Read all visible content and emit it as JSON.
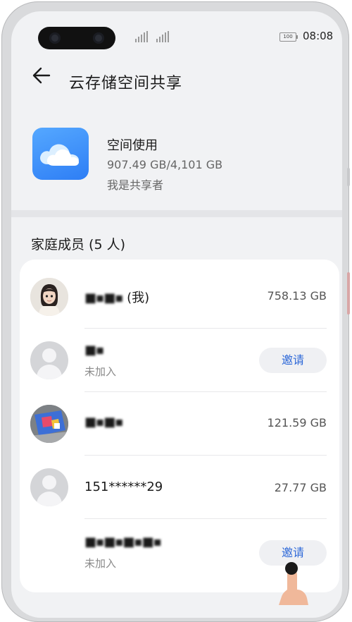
{
  "status_bar": {
    "time": "08:08",
    "battery": "100"
  },
  "header": {
    "title": "云存储空间共享"
  },
  "storage": {
    "title": "空间使用",
    "used": "907.49 GB/4,101 GB",
    "role": "我是共享者"
  },
  "family": {
    "title": "家庭成员 (5 人)",
    "members": [
      {
        "name": "　　",
        "self": "(我)",
        "size": "758.13 GB"
      },
      {
        "name": "　",
        "status": "未加入",
        "action": "邀请"
      },
      {
        "name": "　　",
        "size": "121.59 GB"
      },
      {
        "name": "151******29",
        "size": "27.77 GB"
      },
      {
        "name": "　　　　",
        "status": "未加入",
        "action": "邀请"
      }
    ]
  },
  "colors": {
    "accent": "#2d68d8",
    "tile": "#3b8ef7",
    "background": "#f1f2f4"
  },
  "icons": {
    "back": "arrow-left-icon",
    "app": "cloud-icon",
    "avatar": "user-icon"
  }
}
